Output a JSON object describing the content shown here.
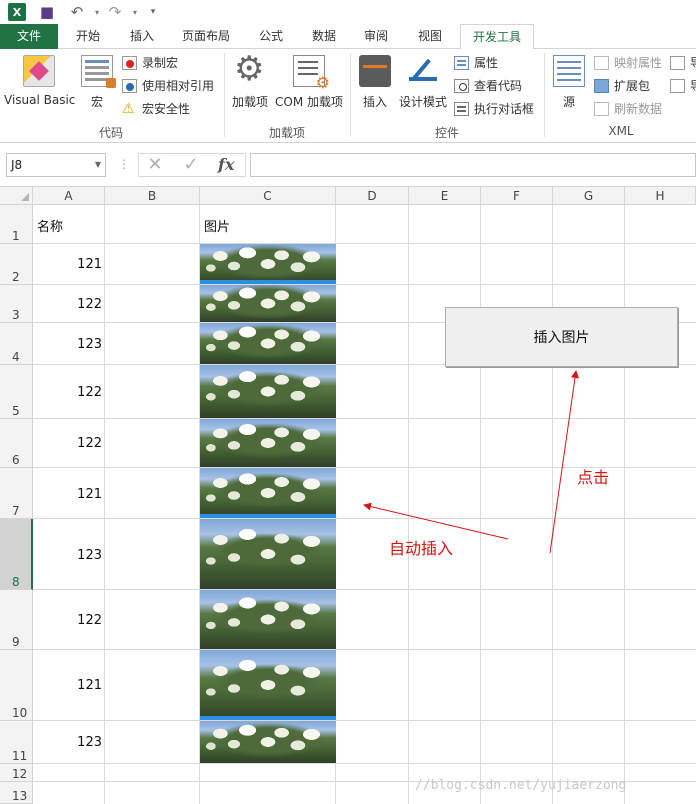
{
  "colors": {
    "excel_green": "#217346",
    "annotation_red": "#dd1111"
  },
  "qat": {
    "icons": [
      "excel-logo-icon",
      "save-icon",
      "undo-icon",
      "redo-icon",
      "customize-qat-icon"
    ],
    "excel_logo_text": "X"
  },
  "tabs": [
    "文件",
    "开始",
    "插入",
    "页面布局",
    "公式",
    "数据",
    "审阅",
    "视图",
    "开发工具"
  ],
  "active_tab": "开发工具",
  "ribbon": {
    "code": {
      "label": "代码",
      "visual_basic": "Visual Basic",
      "macros": "宏",
      "record_macro": "录制宏",
      "relative_refs": "使用相对引用",
      "macro_security": "宏安全性"
    },
    "addins": {
      "label": "加载项",
      "addins": "加载项",
      "com_addins": "COM 加载项"
    },
    "controls": {
      "label": "控件",
      "insert": "插入",
      "design_mode": "设计模式",
      "properties": "属性",
      "view_code": "查看代码",
      "run_dialog": "执行对话框"
    },
    "xml": {
      "label": "XML",
      "source": "源",
      "map_properties": "映射属性",
      "expansion_packs": "扩展包",
      "refresh_data": "刷新数据",
      "import_cut_1": "导",
      "import_cut_2": "导"
    }
  },
  "formula_bar": {
    "name_box": "J8",
    "cancel": "✕",
    "enter": "✓",
    "fx": "fx",
    "value": ""
  },
  "grid": {
    "columns": [
      "A",
      "B",
      "C",
      "D",
      "E",
      "F",
      "G",
      "H"
    ],
    "rows": [
      "1",
      "2",
      "3",
      "4",
      "5",
      "6",
      "7",
      "8",
      "9",
      "10",
      "11",
      "12",
      "13"
    ],
    "selected_row": "8",
    "header_name": "名称",
    "header_picture": "图片",
    "values": [
      "121",
      "122",
      "123",
      "122",
      "122",
      "121",
      "123",
      "122",
      "121",
      "123"
    ]
  },
  "sheet_button": {
    "label": "插入图片"
  },
  "annotations": {
    "click": "点击",
    "auto_insert": "自动插入"
  },
  "watermark": "//blog.csdn.net/yujiaerzong"
}
